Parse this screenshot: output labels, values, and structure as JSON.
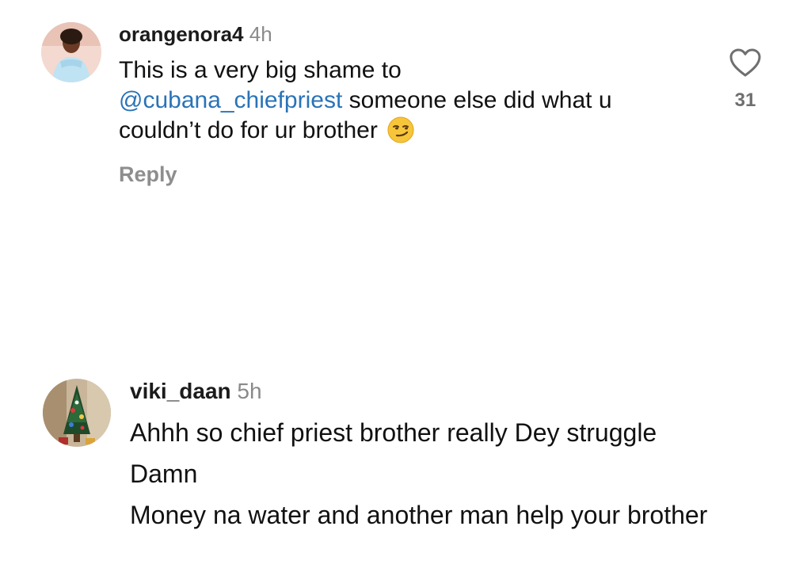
{
  "comments": [
    {
      "username": "orangenora4",
      "time": "4h",
      "text_before": "This is a very big shame to",
      "mention": "@cubana_chiefpriest",
      "text_after": " someone else did what u",
      "text_line3": "couldn’t do for ur brother",
      "emoji": "smirking-face-emoji",
      "reply_label": "Reply",
      "like_count": "31",
      "like_icon": "heart-outline-icon"
    },
    {
      "username": "viki_daan",
      "time": "5h",
      "lines": [
        "Ahhh so chief priest brother really Dey struggle",
        "Damn",
        "Money na water and another man help your brother"
      ]
    }
  ],
  "colors": {
    "mention": "#2a73b8",
    "muted": "#8a8a8a",
    "text": "#111111"
  }
}
